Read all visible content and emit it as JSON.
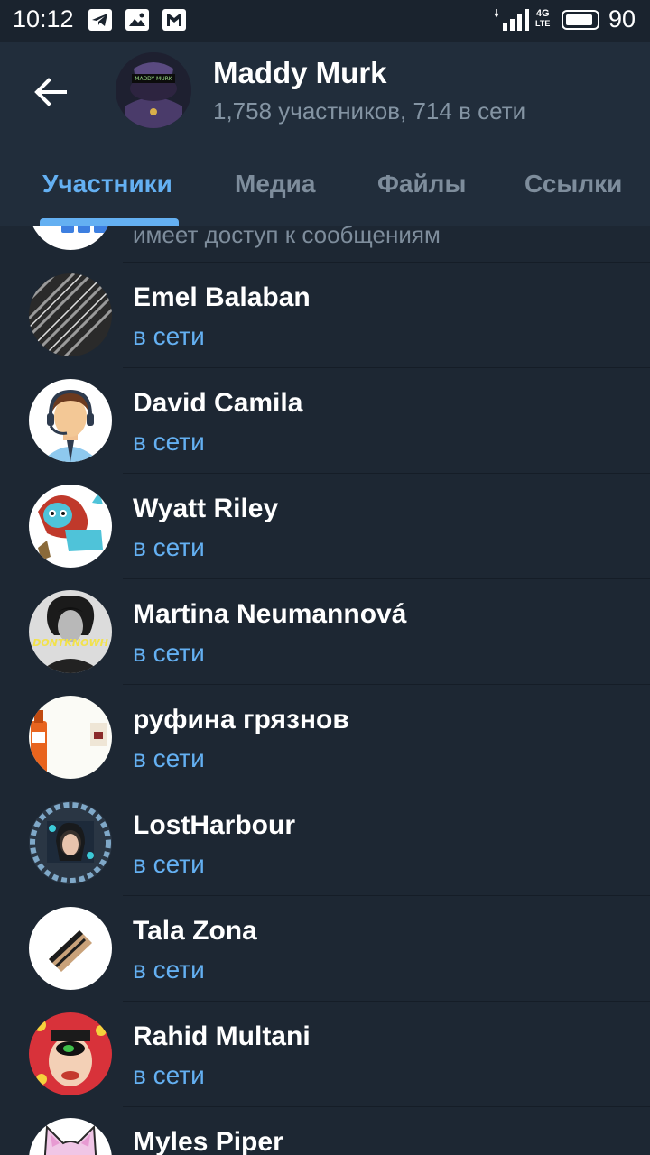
{
  "status_bar": {
    "time": "10:12",
    "network_type_top": "4G",
    "network_type_bottom": "LTE",
    "battery_percent": "90",
    "battery_level": 0.9,
    "notification_icons": [
      "telegram-icon",
      "photo-icon",
      "gmail-icon"
    ]
  },
  "header": {
    "title": "Maddy Murk",
    "subtitle": "1,758 участников, 714 в сети",
    "avatar_text": "MADDY MURK"
  },
  "tabs": [
    {
      "label": "Участники",
      "active": true
    },
    {
      "label": "Медиа",
      "active": false
    },
    {
      "label": "Файлы",
      "active": false
    },
    {
      "label": "Ссылки",
      "active": false
    }
  ],
  "partial_row": {
    "text": "имеет доступ к сообщениям"
  },
  "members": [
    {
      "name": "Emel Balaban",
      "status": "в сети"
    },
    {
      "name": "David Camila",
      "status": "в сети"
    },
    {
      "name": "Wyatt Riley",
      "status": "в сети"
    },
    {
      "name": "Martina Neumannová",
      "status": "в сети",
      "avatar_text": "DONTKNOWH"
    },
    {
      "name": "руфина грязнов",
      "status": "в сети"
    },
    {
      "name": "LostHarbour",
      "status": "в сети"
    },
    {
      "name": "Tala Zona",
      "status": "в сети"
    },
    {
      "name": "Rahid Multani",
      "status": "в сети"
    },
    {
      "name": "Myles Piper",
      "status": ""
    }
  ],
  "colors": {
    "background": "#1d2733",
    "header": "#212d3b",
    "accent": "#64b0f2",
    "muted_text": "#8494a3"
  }
}
